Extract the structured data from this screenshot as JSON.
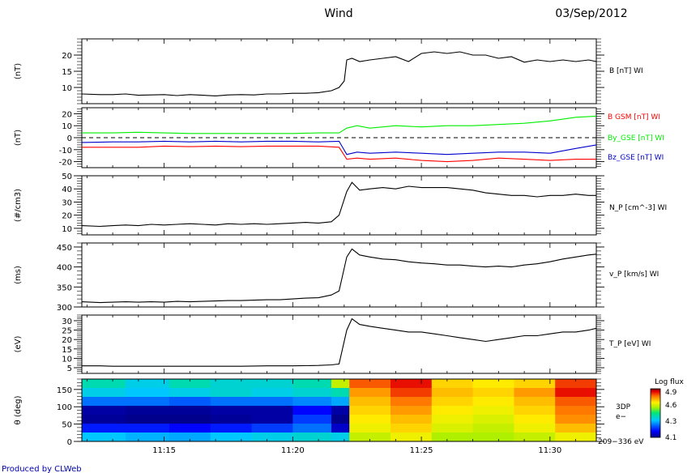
{
  "header": {
    "title": "Wind",
    "date": "03/Sep/2012"
  },
  "footer": {
    "credit": "Produced by CLWeb"
  },
  "time_axis": {
    "ticks": [
      "11:15",
      "11:20",
      "11:25",
      "11:30"
    ],
    "range_minutes": [
      "11:11.8",
      "11:31.8"
    ]
  },
  "colorbar": {
    "title": "Log flux",
    "ticks": [
      "4.9",
      "4.6",
      "4.3",
      "4.1"
    ],
    "range": [
      4.1,
      4.9
    ]
  },
  "colors": {
    "black": "#000000",
    "red": "#ff0000",
    "green": "#00ee00",
    "blue": "#0000cc",
    "credit": "#0000aa"
  },
  "chart_data": [
    {
      "id": "B",
      "type": "line",
      "ylabel": "(nT)",
      "ylim": [
        5,
        25
      ],
      "yticks": [
        10,
        15,
        20
      ],
      "series": [
        {
          "name": "B [nT] WI",
          "color": "#000000",
          "x": [
            11.8,
            12.5,
            13.0,
            13.5,
            14.0,
            14.5,
            15.0,
            15.5,
            16.0,
            16.5,
            17.0,
            17.5,
            18.0,
            18.5,
            19.0,
            19.5,
            20.0,
            20.5,
            21.0,
            21.5,
            21.8,
            22.0,
            22.1,
            22.3,
            22.6,
            23.0,
            23.5,
            24.0,
            24.5,
            25.0,
            25.5,
            26.0,
            26.5,
            27.0,
            27.5,
            28.0,
            28.5,
            29.0,
            29.5,
            30.0,
            30.5,
            31.0,
            31.5,
            31.8
          ],
          "y": [
            8,
            7.8,
            7.8,
            8.0,
            7.6,
            7.7,
            7.8,
            7.5,
            7.8,
            7.6,
            7.4,
            7.7,
            7.8,
            7.7,
            8.0,
            8.0,
            8.2,
            8.2,
            8.4,
            9.0,
            10.0,
            12.0,
            18.5,
            19.0,
            18.0,
            18.5,
            19.0,
            19.5,
            18.0,
            20.5,
            21.0,
            20.5,
            21.0,
            20.0,
            20.0,
            19.0,
            19.5,
            17.8,
            18.5,
            18.0,
            18.5,
            18.0,
            18.5,
            18.0
          ]
        }
      ]
    },
    {
      "id": "GSM",
      "type": "line",
      "ylabel": "(nT)",
      "ylim": [
        -25,
        25
      ],
      "yticks": [
        -20,
        -10,
        0,
        10,
        20
      ],
      "series": [
        {
          "name": "B GSM [nT] WI",
          "color": "#ff0000",
          "x": [
            11.8,
            13.0,
            14.0,
            15.0,
            16.0,
            17.0,
            18.0,
            19.0,
            20.0,
            21.0,
            21.8,
            22.1,
            22.5,
            23.0,
            24.0,
            25.0,
            26.0,
            27.0,
            28.0,
            29.0,
            30.0,
            31.0,
            31.8
          ],
          "y": [
            -8,
            -8,
            -8,
            -7,
            -7.5,
            -7,
            -7.5,
            -7,
            -7,
            -7,
            -8,
            -18,
            -17,
            -18,
            -17,
            -19,
            -20,
            -19,
            -17,
            -18,
            -19,
            -18,
            -18
          ]
        },
        {
          "name": "By_GSE [nT] WI",
          "color": "#00ee00",
          "x": [
            11.8,
            13.0,
            14.0,
            15.0,
            16.0,
            17.0,
            18.0,
            19.0,
            20.0,
            21.0,
            21.8,
            22.1,
            22.5,
            23.0,
            24.0,
            25.0,
            26.0,
            27.0,
            28.0,
            29.0,
            30.0,
            31.0,
            31.8
          ],
          "y": [
            4,
            4,
            4.5,
            4,
            3.5,
            3.5,
            3.5,
            3.5,
            3.5,
            4,
            4,
            8,
            10,
            8,
            10,
            9,
            10,
            10,
            11,
            12,
            14,
            17,
            18
          ]
        },
        {
          "name": "Bz_GSE [nT] WI",
          "color": "#0000cc",
          "x": [
            11.8,
            13.0,
            14.0,
            15.0,
            16.0,
            17.0,
            18.0,
            19.0,
            20.0,
            21.0,
            21.8,
            22.1,
            22.5,
            23.0,
            24.0,
            25.0,
            26.0,
            27.0,
            28.0,
            29.0,
            30.0,
            31.0,
            31.8
          ],
          "y": [
            -4,
            -3.5,
            -3.5,
            -3,
            -3.5,
            -3,
            -3.5,
            -3,
            -3,
            -3.5,
            -3,
            -14,
            -12,
            -13,
            -12,
            -13,
            -14,
            -13,
            -12,
            -12,
            -13,
            -9,
            -6
          ]
        },
        {
          "name": "",
          "color": "#000000",
          "dashed": true,
          "x": [
            11.8,
            31.8
          ],
          "y": [
            0,
            0
          ]
        }
      ]
    },
    {
      "id": "NP",
      "type": "line",
      "ylabel": "(#/cm3)",
      "ylim": [
        5,
        50
      ],
      "yticks": [
        10,
        20,
        30,
        40,
        50
      ],
      "series": [
        {
          "name": "N_P [cm^-3] WI",
          "color": "#000000",
          "x": [
            11.8,
            12.5,
            13.0,
            13.5,
            14.0,
            14.5,
            15.0,
            15.5,
            16.0,
            16.5,
            17.0,
            17.5,
            18.0,
            18.5,
            19.0,
            19.5,
            20.0,
            20.5,
            21.0,
            21.5,
            21.8,
            22.1,
            22.3,
            22.6,
            23.0,
            23.5,
            24.0,
            24.5,
            25.0,
            25.5,
            26.0,
            26.5,
            27.0,
            27.5,
            28.0,
            28.5,
            29.0,
            29.5,
            30.0,
            30.5,
            31.0,
            31.5,
            31.8
          ],
          "y": [
            12,
            11.5,
            12,
            12.5,
            12,
            13,
            12.5,
            13,
            13.5,
            13,
            12.5,
            13.5,
            13,
            13.5,
            13,
            13.5,
            14,
            14.5,
            14,
            15,
            20,
            38,
            45,
            39,
            40,
            41,
            40,
            42,
            41,
            41,
            41,
            40,
            39,
            37,
            36,
            35,
            35,
            34,
            35,
            35,
            36,
            35,
            35
          ]
        }
      ]
    },
    {
      "id": "VP",
      "type": "line",
      "ylabel": "(ms)",
      "ylim": [
        300,
        460
      ],
      "yticks": [
        300,
        350,
        400,
        450
      ],
      "series": [
        {
          "name": "v_P [km/s] WI",
          "color": "#000000",
          "x": [
            11.8,
            12.5,
            13.0,
            13.5,
            14.0,
            14.5,
            15.0,
            15.5,
            16.0,
            16.5,
            17.0,
            17.5,
            18.0,
            18.5,
            19.0,
            19.5,
            20.0,
            20.5,
            21.0,
            21.5,
            21.8,
            22.1,
            22.3,
            22.6,
            23.0,
            23.5,
            24.0,
            24.5,
            25.0,
            25.5,
            26.0,
            26.5,
            27.0,
            27.5,
            28.0,
            28.5,
            29.0,
            29.5,
            30.0,
            30.5,
            31.0,
            31.5,
            31.8
          ],
          "y": [
            313,
            311,
            312,
            313,
            312,
            313,
            312,
            314,
            313,
            314,
            315,
            316,
            316,
            317,
            318,
            318,
            320,
            322,
            323,
            330,
            340,
            425,
            445,
            430,
            425,
            420,
            418,
            413,
            410,
            408,
            405,
            405,
            402,
            400,
            402,
            400,
            405,
            408,
            413,
            420,
            425,
            430,
            432
          ]
        }
      ]
    },
    {
      "id": "TP",
      "type": "line",
      "ylabel": "(eV)",
      "ylim": [
        2,
        33
      ],
      "yticks": [
        5,
        10,
        15,
        20,
        25,
        30
      ],
      "series": [
        {
          "name": "T_P [eV] WI",
          "color": "#000000",
          "x": [
            11.8,
            12.5,
            13.0,
            14.0,
            15.0,
            16.0,
            17.0,
            18.0,
            19.0,
            20.0,
            21.0,
            21.5,
            21.8,
            22.1,
            22.3,
            22.6,
            23.0,
            23.5,
            24.0,
            24.5,
            25.0,
            25.5,
            26.0,
            26.5,
            27.0,
            27.5,
            28.0,
            28.5,
            29.0,
            29.5,
            30.0,
            30.5,
            31.0,
            31.5,
            31.8
          ],
          "y": [
            6,
            6,
            5.8,
            5.8,
            5.8,
            5.8,
            5.8,
            5.8,
            6,
            6,
            6.2,
            6.5,
            7,
            25,
            31,
            28,
            27,
            26,
            25,
            24,
            24,
            23,
            22,
            21,
            20,
            19,
            20,
            21,
            22,
            22,
            23,
            24,
            24,
            25,
            26
          ]
        }
      ]
    },
    {
      "id": "3DP",
      "type": "heatmap",
      "ylabel": "θ (deg)",
      "ylim": [
        0,
        180
      ],
      "yticks": [
        0,
        50,
        100,
        150
      ],
      "label_lines": [
        "3DP",
        "e−"
      ],
      "energy_label": "209−336 eV",
      "x_edges": [
        11.8,
        13.5,
        15.2,
        16.8,
        18.4,
        20.0,
        21.5,
        22.2,
        23.8,
        25.4,
        27.0,
        28.6,
        30.2,
        31.8
      ],
      "rows_top_to_bottom": [
        [
          4.45,
          4.4,
          4.45,
          4.42,
          4.42,
          4.45,
          4.62,
          4.8,
          4.85,
          4.7,
          4.68,
          4.7,
          4.82
        ],
        [
          4.4,
          4.38,
          4.4,
          4.42,
          4.4,
          4.42,
          4.45,
          4.75,
          4.82,
          4.72,
          4.7,
          4.75,
          4.85
        ],
        [
          4.3,
          4.3,
          4.28,
          4.3,
          4.3,
          4.32,
          4.35,
          4.72,
          4.78,
          4.7,
          4.68,
          4.72,
          4.8
        ],
        [
          4.12,
          4.11,
          4.11,
          4.12,
          4.12,
          4.2,
          4.12,
          4.7,
          4.75,
          4.68,
          4.66,
          4.7,
          4.78
        ],
        [
          4.11,
          4.1,
          4.1,
          4.11,
          4.12,
          4.25,
          4.1,
          4.68,
          4.72,
          4.66,
          4.64,
          4.68,
          4.76
        ],
        [
          4.22,
          4.22,
          4.2,
          4.22,
          4.25,
          4.3,
          4.15,
          4.66,
          4.7,
          4.64,
          4.62,
          4.66,
          4.72
        ],
        [
          4.38,
          4.36,
          4.35,
          4.38,
          4.4,
          4.42,
          4.4,
          4.62,
          4.66,
          4.6,
          4.6,
          4.62,
          4.66
        ]
      ]
    }
  ]
}
